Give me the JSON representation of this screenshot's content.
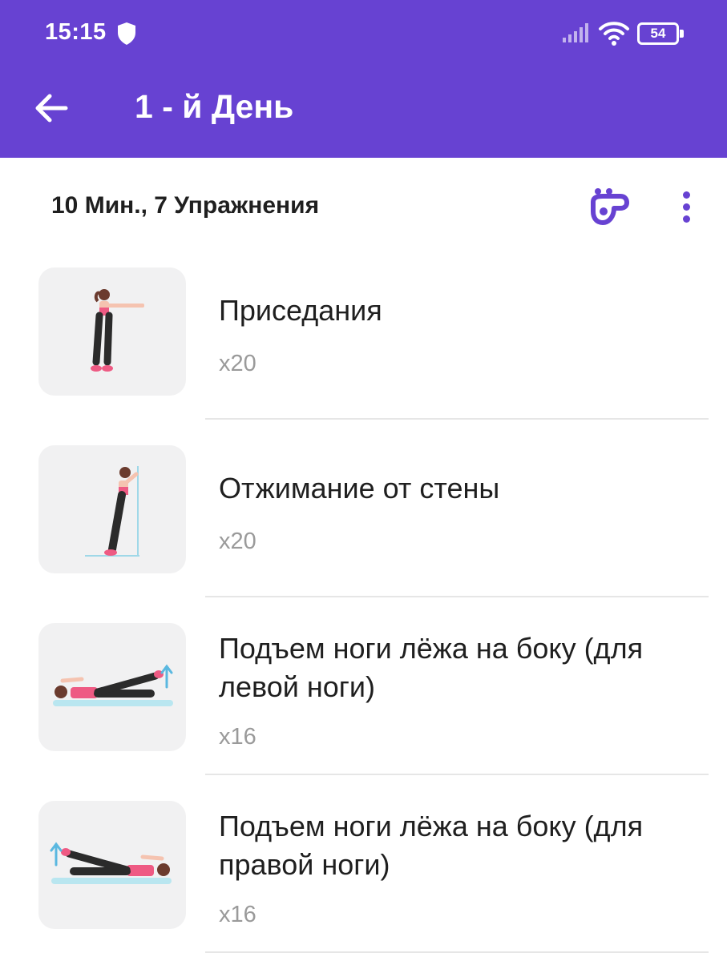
{
  "status_bar": {
    "time": "15:15",
    "battery": "54"
  },
  "header": {
    "title": "1 - й День"
  },
  "summary": "10 Мин., 7 Упражнения",
  "colors": {
    "primary": "#6742d2",
    "text": "#1f1f1f",
    "muted": "#9a9a9a"
  },
  "icons": {
    "back": "arrow-left-icon",
    "coach": "coach-whistle-icon",
    "more": "more-vertical-icon"
  },
  "exercises": [
    {
      "name": "Приседания",
      "reps": "x20"
    },
    {
      "name": "Отжимание от стены",
      "reps": "x20"
    },
    {
      "name": "Подъем ноги лёжа на боку (для левой ноги)",
      "reps": "x16"
    },
    {
      "name": "Подъем ноги лёжа на боку (для правой ноги)",
      "reps": "x16"
    }
  ]
}
